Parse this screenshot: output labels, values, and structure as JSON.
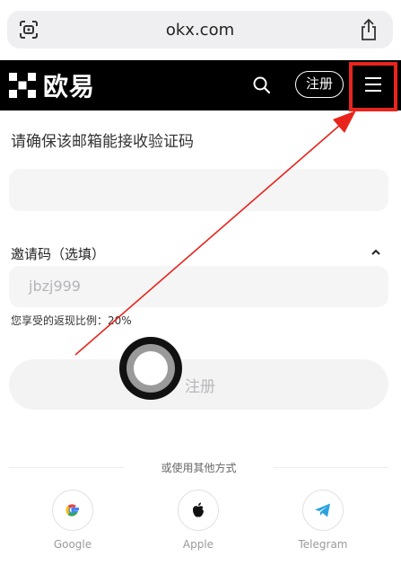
{
  "browser": {
    "url": "okx.com",
    "icons": {
      "left": "scan-icon",
      "right": "share-icon"
    }
  },
  "navbar": {
    "logo_text": "欧易",
    "register_label": "注册",
    "icons": [
      "okx-logo-icon",
      "search-icon",
      "menu-icon"
    ]
  },
  "form": {
    "subtitle": "请确保该邮箱能接收验证码",
    "email_value": "",
    "invite_label": "邀请码（选填）",
    "invite_code": "jbzj999",
    "rebate_text": "您享受的返现比例：20%",
    "register_button": "注册"
  },
  "social": {
    "divider_text": "或使用其他方式",
    "options": [
      {
        "label": "Google",
        "icon": "google-icon"
      },
      {
        "label": "Apple",
        "icon": "apple-icon"
      },
      {
        "label": "Telegram",
        "icon": "telegram-icon"
      }
    ]
  },
  "annotation": {
    "color": "#e8241d"
  },
  "colors": {
    "navbar_bg": "#000000",
    "input_bg": "#f5f5f6",
    "accent": "#e8241d"
  }
}
